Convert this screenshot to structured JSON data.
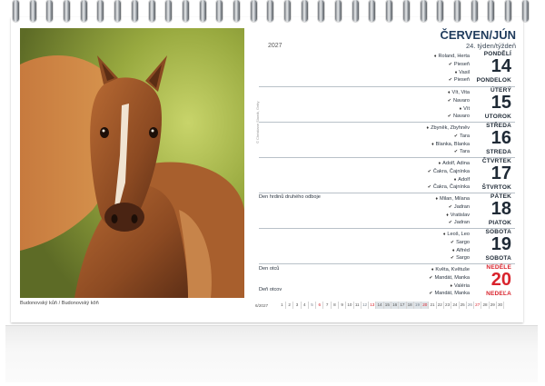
{
  "header": {
    "month": "ČERVEN/JÚN",
    "week": "24. týden/týždeň",
    "year": "2027"
  },
  "photo": {
    "caption": "Budonovský kůň / Budonovský kôň",
    "copyright": "© Christiane Slawik, Getty"
  },
  "days": [
    {
      "cz": "PONDĚLÍ",
      "num": "14",
      "sk": "PONDELOK",
      "names": [
        {
          "icon": "candle",
          "text": "Roland, Herta"
        },
        {
          "icon": "leaf",
          "text": "Pieseň"
        },
        {
          "icon": "candle",
          "text": "Vasil"
        },
        {
          "icon": "leaf",
          "text": "Pieseň"
        }
      ],
      "holidays": []
    },
    {
      "cz": "ÚTERÝ",
      "num": "15",
      "sk": "UTOROK",
      "names": [
        {
          "icon": "candle",
          "text": "Vít, Vita"
        },
        {
          "icon": "leaf",
          "text": "Navaro"
        },
        {
          "icon": "candle",
          "text": "Vít"
        },
        {
          "icon": "leaf",
          "text": "Navaro"
        }
      ],
      "holidays": []
    },
    {
      "cz": "STŘEDA",
      "num": "16",
      "sk": "STREDA",
      "names": [
        {
          "icon": "candle",
          "text": "Zbyněk, Zbyhněv"
        },
        {
          "icon": "leaf",
          "text": "Tara"
        },
        {
          "icon": "candle",
          "text": "Blanka, Blanka"
        },
        {
          "icon": "leaf",
          "text": "Tara"
        }
      ],
      "holidays": []
    },
    {
      "cz": "ČTVRTEK",
      "num": "17",
      "sk": "ŠTVRTOK",
      "names": [
        {
          "icon": "candle",
          "text": "Adolf, Adina"
        },
        {
          "icon": "leaf",
          "text": "Čakra, Čajnínka"
        },
        {
          "icon": "candle",
          "text": "Adolf"
        },
        {
          "icon": "leaf",
          "text": "Čakra, Čajnínka"
        }
      ],
      "holidays": []
    },
    {
      "cz": "PÁTEK",
      "num": "18",
      "sk": "PIATOK",
      "names": [
        {
          "icon": "candle",
          "text": "Milan, Milana"
        },
        {
          "icon": "leaf",
          "text": "Jadran"
        },
        {
          "icon": "candle",
          "text": "Vratislav"
        },
        {
          "icon": "leaf",
          "text": "Jadran"
        }
      ],
      "holidays": [
        {
          "text": "Den hrdinů druhého odboje"
        }
      ]
    },
    {
      "cz": "SOBOTA",
      "num": "19",
      "sk": "SOBOTA",
      "names": [
        {
          "icon": "candle",
          "text": "Leoš, Leo"
        },
        {
          "icon": "leaf",
          "text": "Sargo"
        },
        {
          "icon": "candle",
          "text": "Alfréd"
        },
        {
          "icon": "leaf",
          "text": "Sargo"
        }
      ],
      "holidays": []
    },
    {
      "cz": "NEDĚLE",
      "num": "20",
      "sk": "NEDEĽA",
      "sunday": true,
      "names": [
        {
          "icon": "candle",
          "text": "Květa, Květuše"
        },
        {
          "icon": "leaf",
          "text": "Mandát, Manka"
        },
        {
          "icon": "candle",
          "text": "Valéria"
        },
        {
          "icon": "leaf",
          "text": "Mandát, Manka"
        }
      ],
      "holidays": [
        {
          "text": "Den otců"
        },
        {
          "text": "Deň otcov"
        }
      ]
    }
  ],
  "minical": {
    "label": "6/2027",
    "days": [
      "1",
      "2",
      "3",
      "4",
      "5",
      "6",
      "7",
      "8",
      "9",
      "10",
      "11",
      "12",
      "13",
      "14",
      "15",
      "16",
      "17",
      "18",
      "19",
      "20",
      "21",
      "22",
      "23",
      "24",
      "25",
      "26",
      "27",
      "28",
      "29",
      "30"
    ],
    "current_week": [
      "14",
      "15",
      "16",
      "17",
      "18",
      "19",
      "20"
    ],
    "saturdays": [
      "5",
      "12",
      "19",
      "26"
    ],
    "sundays": [
      "6",
      "13",
      "20",
      "27"
    ]
  },
  "colors": {
    "accent": "#1f3b5c",
    "sunday": "#d9232c"
  }
}
